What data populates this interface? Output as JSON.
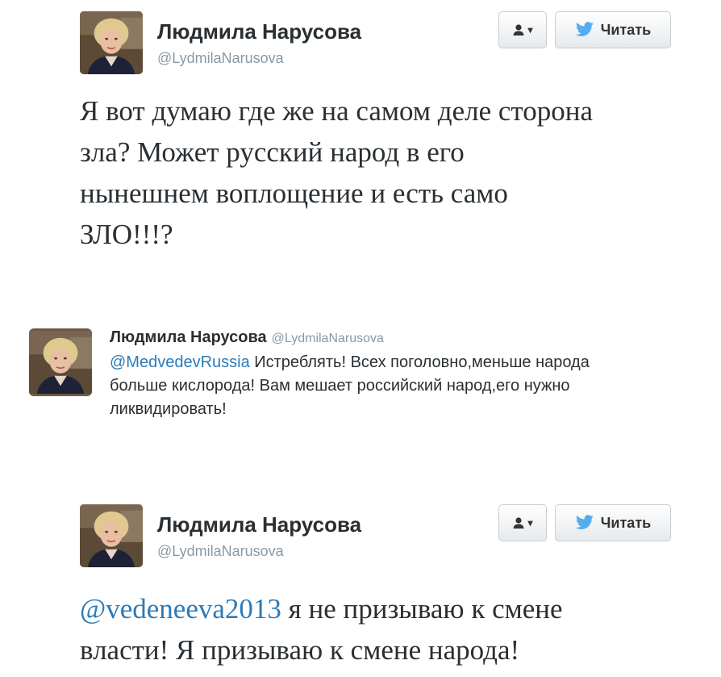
{
  "tweet1": {
    "author": "Людмила Нарусова",
    "handle": "@LydmilaNarusova",
    "follow_label": "Читать",
    "text_lines": [
      "Я вот думаю где же на самом деле сторона",
      "зла? Может русский народ в его",
      "нынешнем воплощение и есть само",
      "ЗЛО!!!?"
    ]
  },
  "tweet2": {
    "author": "Людмила Нарусова",
    "handle": "@LydmilaNarusova",
    "mention": "@MedvedevRussia",
    "text_lines": [
      " Истреблять! Всех поголовно,меньше народа",
      "больше кислорода! Вам мешает российский народ,его нужно",
      "ликвидировать!"
    ]
  },
  "tweet3": {
    "author": "Людмила Нарусова",
    "handle": "@LydmilaNarusova",
    "follow_label": "Читать",
    "mention": "@vedeneeva2013",
    "text_lines": [
      " я не призываю к смене",
      "власти! Я призываю к смене народа!"
    ]
  },
  "icons": {
    "user_action": "user-silhouette-icon",
    "bird": "twitter-bird-icon",
    "caret": "caret-down-icon"
  },
  "colors": {
    "mention": "#2b7bb9",
    "bird": "#55acee",
    "handle": "#8899a6"
  }
}
